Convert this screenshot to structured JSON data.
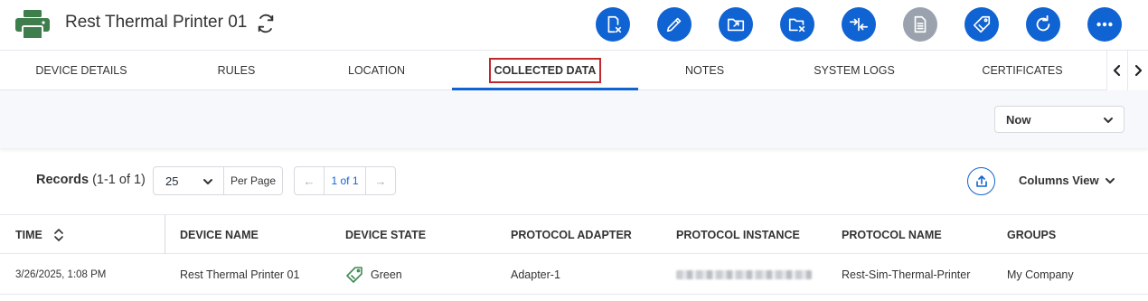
{
  "header": {
    "title": "Rest Thermal Printer 01",
    "actions": [
      {
        "name": "remove-device-icon",
        "disabled": false
      },
      {
        "name": "edit-icon",
        "disabled": false
      },
      {
        "name": "export-device-icon",
        "disabled": false
      },
      {
        "name": "delete-folder-icon",
        "disabled": false
      },
      {
        "name": "merge-icon",
        "disabled": false
      },
      {
        "name": "document-icon",
        "disabled": true
      },
      {
        "name": "tag-icon",
        "disabled": false
      },
      {
        "name": "reload-icon",
        "disabled": false
      },
      {
        "name": "more-icon",
        "disabled": false
      }
    ]
  },
  "tabs": [
    {
      "label": "DEVICE DETAILS",
      "active": false
    },
    {
      "label": "RULES",
      "active": false
    },
    {
      "label": "LOCATION",
      "active": false
    },
    {
      "label": "COLLECTED DATA",
      "active": true
    },
    {
      "label": "NOTES",
      "active": false
    },
    {
      "label": "SYSTEM LOGS",
      "active": false
    },
    {
      "label": "CERTIFICATES",
      "active": false
    }
  ],
  "filter": {
    "time_range": "Now"
  },
  "records": {
    "label": "Records",
    "range": "(1-1 of 1)",
    "page_size": "25",
    "per_page_label": "Per Page",
    "page_text": "1 of 1",
    "prev_icon": "←",
    "next_icon": "→",
    "columns_view_label": "Columns View"
  },
  "table": {
    "columns": [
      "TIME",
      "DEVICE NAME",
      "DEVICE STATE",
      "PROTOCOL ADAPTER",
      "PROTOCOL INSTANCE",
      "PROTOCOL NAME",
      "GROUPS"
    ],
    "rows": [
      {
        "time": "3/26/2025, 1:08 PM",
        "device_name": "Rest Thermal Printer 01",
        "device_state": "Green",
        "protocol_adapter": "Adapter-1",
        "protocol_instance": "",
        "protocol_name": "Rest-Sim-Thermal-Printer",
        "groups": "My Company"
      }
    ]
  },
  "colors": {
    "accent": "#1063d2",
    "disabled": "#9aa3ad",
    "printer_green": "#3e7d4c",
    "highlight": "#c0282c",
    "state_green": "#3e8a55"
  }
}
